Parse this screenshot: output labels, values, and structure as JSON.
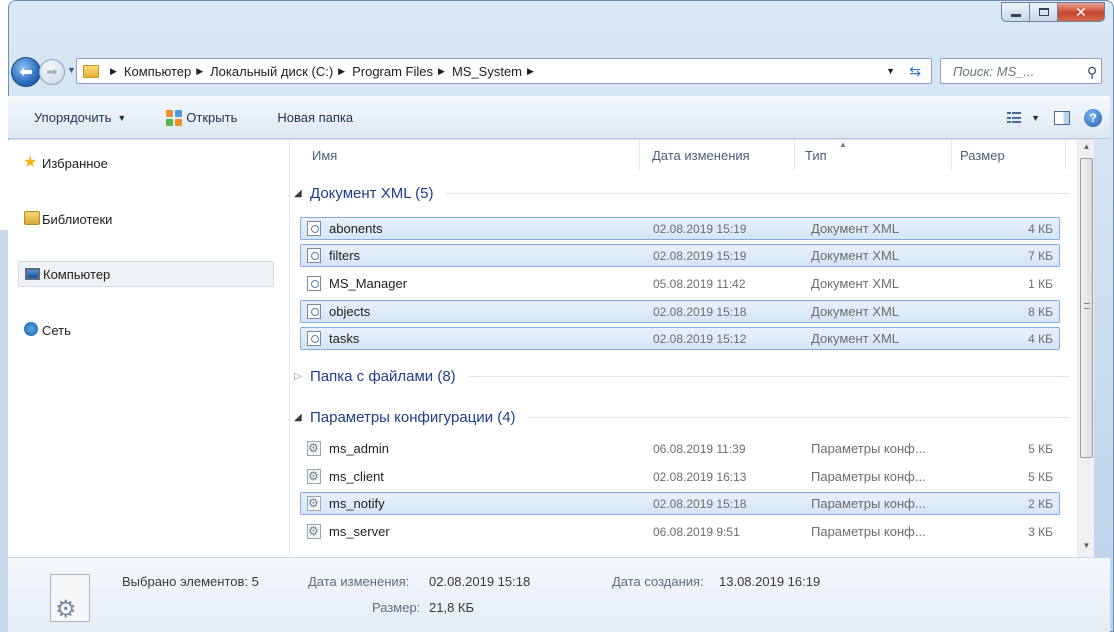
{
  "nav": {
    "breadcrumbs": [
      "Компьютер",
      "Локальный диск (C:)",
      "Program Files",
      "MS_System"
    ],
    "search_placeholder": "Поиск: MS_..."
  },
  "toolbar": {
    "organize_label": "Упорядочить",
    "open_label": "Открыть",
    "new_folder_label": "Новая папка"
  },
  "sidebar": {
    "items": [
      {
        "label": "Избранное",
        "icon": "star-icon"
      },
      {
        "label": "Библиотеки",
        "icon": "library-icon"
      },
      {
        "label": "Компьютер",
        "icon": "computer-icon",
        "selected": true
      },
      {
        "label": "Сеть",
        "icon": "network-icon"
      }
    ]
  },
  "columns": {
    "name": "Имя",
    "date": "Дата изменения",
    "type": "Тип",
    "size": "Размер"
  },
  "groups": [
    {
      "label": "Документ XML (5)",
      "expanded": true,
      "rows": [
        {
          "name": "abonents",
          "date": "02.08.2019 15:19",
          "type": "Документ XML",
          "size": "4 КБ",
          "selected": true
        },
        {
          "name": "filters",
          "date": "02.08.2019 15:19",
          "type": "Документ XML",
          "size": "7 КБ",
          "selected": true
        },
        {
          "name": "MS_Manager",
          "date": "05.08.2019 11:42",
          "type": "Документ XML",
          "size": "1 КБ",
          "selected": false
        },
        {
          "name": "objects",
          "date": "02.08.2019 15:18",
          "type": "Документ XML",
          "size": "8 КБ",
          "selected": true
        },
        {
          "name": "tasks",
          "date": "02.08.2019 15:12",
          "type": "Документ XML",
          "size": "4 КБ",
          "selected": true
        }
      ]
    },
    {
      "label": "Папка с файлами (8)",
      "expanded": false,
      "rows": []
    },
    {
      "label": "Параметры конфигурации (4)",
      "expanded": true,
      "rows": [
        {
          "name": "ms_admin",
          "date": "06.08.2019 11:39",
          "type": "Параметры конф...",
          "size": "5 КБ",
          "selected": false
        },
        {
          "name": "ms_client",
          "date": "02.08.2019 16:13",
          "type": "Параметры конф...",
          "size": "5 КБ",
          "selected": false
        },
        {
          "name": "ms_notify",
          "date": "02.08.2019 15:18",
          "type": "Параметры конф...",
          "size": "2 КБ",
          "selected": true
        },
        {
          "name": "ms_server",
          "date": "06.08.2019 9:51",
          "type": "Параметры конф...",
          "size": "3 КБ",
          "selected": false
        }
      ]
    }
  ],
  "details": {
    "selected_count": "Выбрано элементов: 5",
    "modified_key": "Дата изменения:",
    "modified_value": "02.08.2019 15:18",
    "created_key": "Дата создания:",
    "created_value": "13.08.2019 16:19",
    "size_key": "Размер:",
    "size_value": "21,8 КБ"
  },
  "colors": {
    "selection_fill": "#d9e8f9",
    "selection_border": "#84acdd",
    "group_header": "#1e3e8c"
  }
}
